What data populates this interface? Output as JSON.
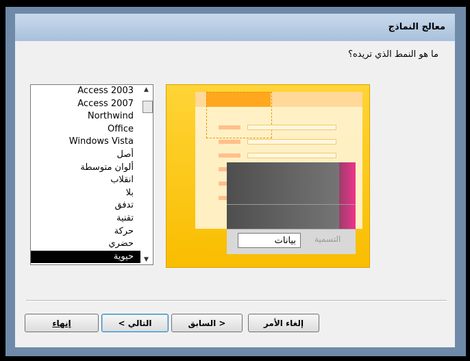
{
  "window": {
    "title": "معالج النماذج"
  },
  "question": "ما هو النمط الذي تريده؟",
  "styles_list": {
    "items": [
      "Access 2003",
      "Access 2007",
      "Northwind",
      "Office",
      "Windows Vista",
      "أصل",
      "ألوان متوسطة",
      "انقلاب",
      "بلا",
      "تدفق",
      "تقنية",
      "حركة",
      "حضري",
      "حيوية"
    ],
    "selected": "حيوية"
  },
  "preview": {
    "caption_label": "التسمية",
    "value_label": "بيانات"
  },
  "buttons": {
    "cancel": "إلغاء الأمر",
    "back": "< السابق",
    "next": "التالي >",
    "finish": "إنهاء"
  },
  "colors": {
    "preview_bg": "#ffd437",
    "accent_pink": "#f0338c"
  }
}
